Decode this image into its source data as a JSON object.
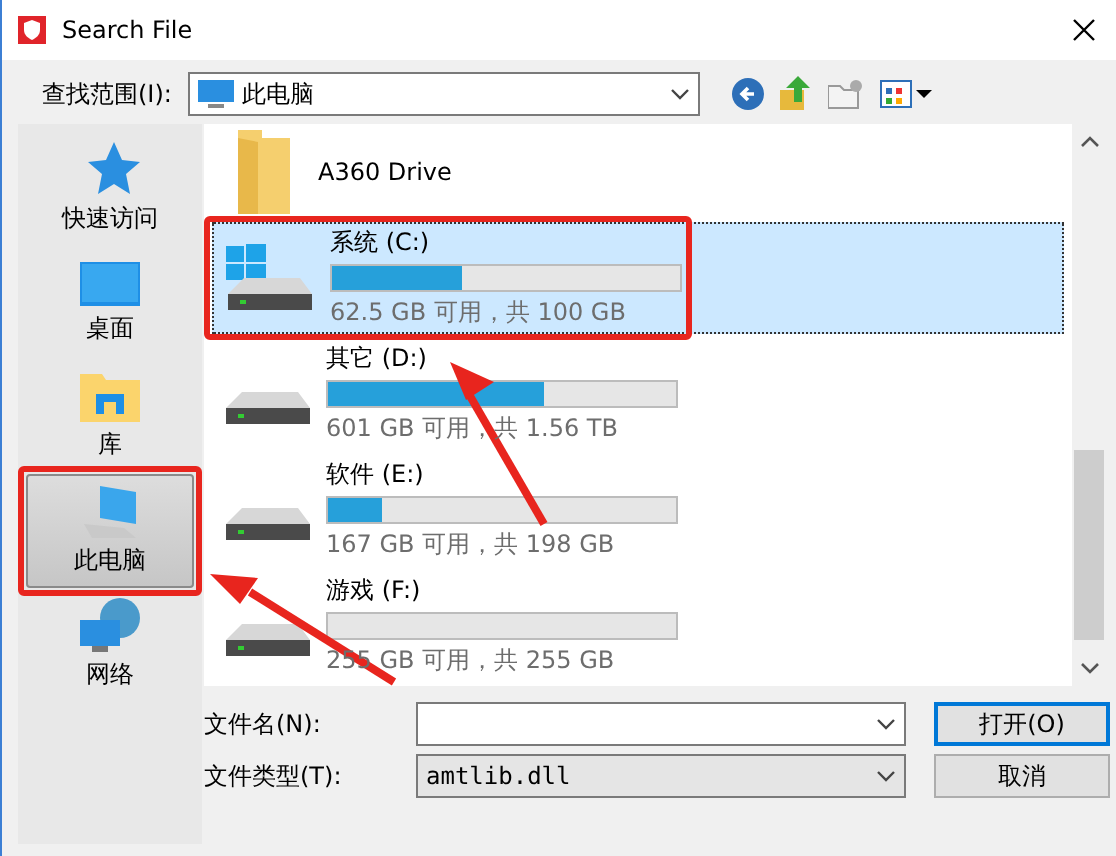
{
  "window": {
    "title": "Search File"
  },
  "look_in": {
    "label": "查找范围(I):",
    "value": "此电脑"
  },
  "sidebar": {
    "items": [
      {
        "label": "快速访问",
        "kind": "star",
        "selected": false,
        "highlighted": false
      },
      {
        "label": "桌面",
        "kind": "desktop",
        "selected": false,
        "highlighted": false
      },
      {
        "label": "库",
        "kind": "library",
        "selected": false,
        "highlighted": false
      },
      {
        "label": "此电脑",
        "kind": "computer",
        "selected": true,
        "highlighted": true
      },
      {
        "label": "网络",
        "kind": "network",
        "selected": false,
        "highlighted": false
      }
    ]
  },
  "items": [
    {
      "kind": "folder",
      "name": "A360 Drive",
      "selected": false,
      "highlighted": false
    },
    {
      "kind": "drive",
      "system": true,
      "name": "系统 (C:)",
      "level": 0.375,
      "space": "62.5 GB 可用，共 100 GB",
      "selected": true,
      "highlighted": true
    },
    {
      "kind": "drive",
      "system": false,
      "name": "其它 (D:)",
      "level": 0.62,
      "space": "601 GB 可用，共 1.56 TB",
      "selected": false,
      "highlighted": false
    },
    {
      "kind": "drive",
      "system": false,
      "name": "软件 (E:)",
      "level": 0.156,
      "space": "167 GB 可用，共 198 GB",
      "selected": false,
      "highlighted": false
    },
    {
      "kind": "drive",
      "system": false,
      "name": "游戏 (F:)",
      "level": 0.0,
      "space": "255 GB 可用，共 255 GB",
      "selected": false,
      "highlighted": false
    }
  ],
  "file_name": {
    "label": "文件名(N):"
  },
  "file_type": {
    "label": "文件类型(T):",
    "value": "amtlib.dll"
  },
  "buttons": [
    {
      "label": "打开(O)",
      "default": true
    },
    {
      "label": "取消",
      "default": false
    }
  ]
}
